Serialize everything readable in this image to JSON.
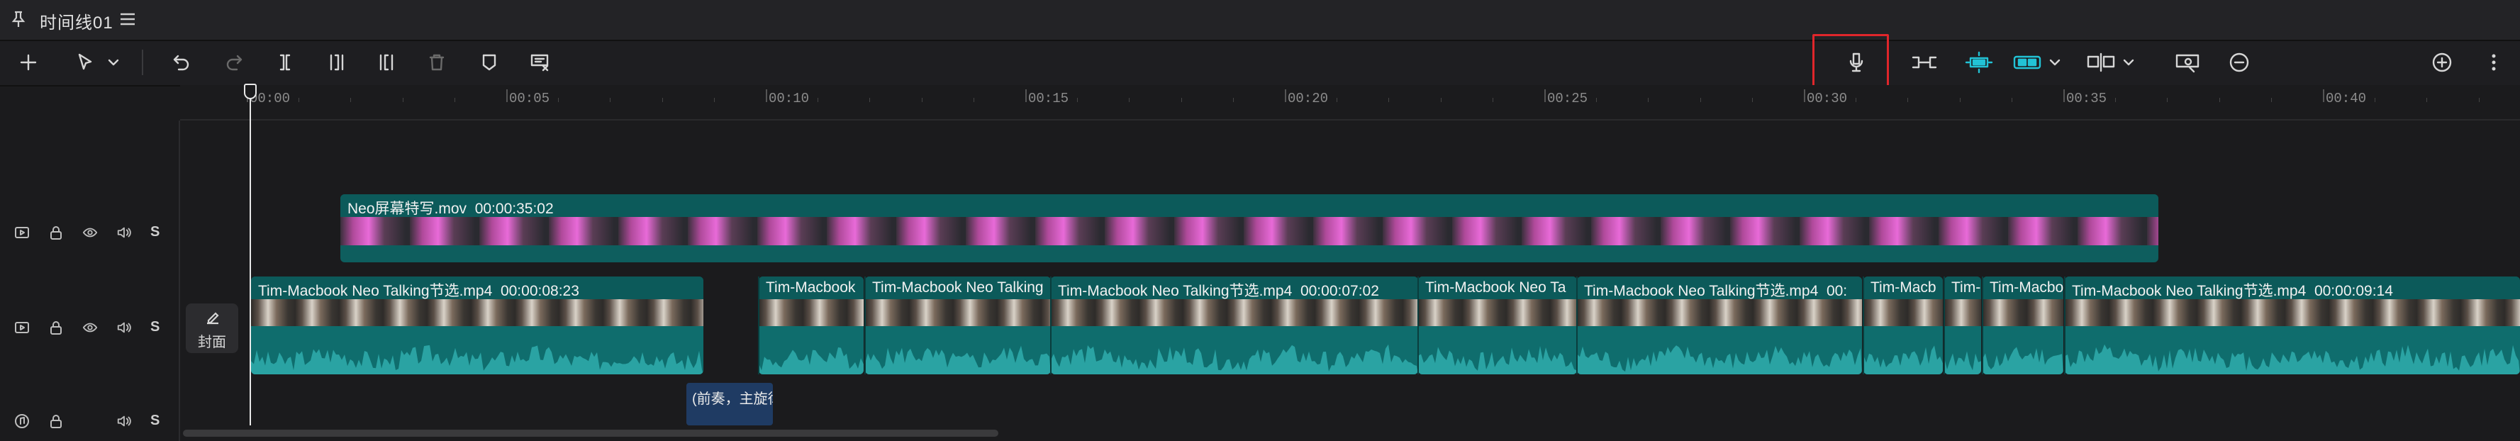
{
  "titlebar": {
    "title": "时间线01",
    "pin_icon": "pin-icon",
    "menu_icon": "hamburger-menu-icon"
  },
  "toolbar": {
    "left_tools": [
      "add-icon",
      "select-cursor-icon",
      "chevron-down-icon",
      "undo-icon",
      "redo-icon",
      "split-icon",
      "split-left-icon",
      "split-right-icon",
      "delete-icon",
      "marker-icon",
      "freeze-frame-icon"
    ],
    "right_tools": [
      "record-microphone-icon",
      "link-icon",
      "auto-snap-icon",
      "preview-axis-icon",
      "chevron-down-icon",
      "split-screen-icon",
      "chevron-down-icon",
      "fit-to-view-icon",
      "zoom-out-icon",
      "zoom-in-icon",
      "more-icon"
    ],
    "zoom_level": 0.32
  },
  "ruler": {
    "ticks": [
      "00:00",
      "00:05",
      "00:10",
      "00:15",
      "00:20",
      "00:25",
      "00:30",
      "00:35",
      "00:40"
    ]
  },
  "tracks": [
    {
      "type": "video",
      "controls": [
        "video-track-icon",
        "lock-icon",
        "eye-icon",
        "volume-icon"
      ],
      "solo": "S",
      "clips": [
        {
          "name": "Neo屏幕特写.mov",
          "duration": "00:00:35:02"
        }
      ]
    },
    {
      "type": "main-video",
      "controls": [
        "video-track-icon",
        "lock-icon",
        "eye-icon",
        "volume-icon"
      ],
      "solo": "S",
      "cover_label": "封面",
      "clips": [
        {
          "name": "Tim-Macbook Neo Talking节选.mp4",
          "duration": "00:00:08:23"
        },
        {
          "name": "Tim-Macbook",
          "duration": ""
        },
        {
          "name": "Tim-Macbook Neo Talking",
          "duration": ""
        },
        {
          "name": "Tim-Macbook Neo Talking节选.mp4",
          "duration": "00:00:07:02"
        },
        {
          "name": "Tim-Macbook Neo Ta",
          "duration": ""
        },
        {
          "name": "Tim-Macbook Neo Talking节选.mp4",
          "duration": "00:"
        },
        {
          "name": "Tim-Macb",
          "duration": ""
        },
        {
          "name": "Tim-",
          "duration": ""
        },
        {
          "name": "Tim-Macbo",
          "duration": ""
        },
        {
          "name": "Tim-Macbook Neo Talking节选.mp4",
          "duration": "00:00:09:14"
        }
      ]
    },
    {
      "type": "audio",
      "controls": [
        "audio-track-icon",
        "lock-icon",
        "volume-icon"
      ],
      "solo": "S",
      "clips": [
        {
          "name": "(前奏，主旋律"
        }
      ]
    }
  ],
  "colors": {
    "accent": "#0e5e5e",
    "highlight": "#e0262b",
    "subtitle": "#1f3b63"
  }
}
